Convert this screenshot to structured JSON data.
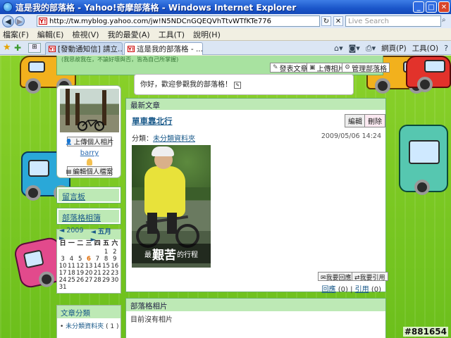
{
  "window": {
    "title": "這是我的部落格 - Yahoo!奇摩部落格 - Windows Internet Explorer",
    "url": "http://tw.myblog.yahoo.com/jw!N5NDCnGQEQVhTtvWTfKTe776",
    "search_placeholder": "Live Search",
    "url_fav": "Y!",
    "min": "_",
    "max": "□",
    "close": "✕"
  },
  "menu": [
    "檔案(F)",
    "編輯(E)",
    "檢視(V)",
    "我的最愛(A)",
    "工具(T)",
    "說明(H)"
  ],
  "tabs": [
    {
      "label": "[發動通知信] 請立...",
      "active": false
    },
    {
      "label": "這是我的部落格 - ...",
      "active": true
    }
  ],
  "commands": {
    "page": "網頁(P)",
    "tools": "工具(O)"
  },
  "topbar": {
    "blurb": "(我思故我在，不論好壞與否，皆為自己所掌握)",
    "post_btn": "發表文章",
    "upload_btn": "上傳相片",
    "manage_btn": "管理部落格"
  },
  "welcome": "你好，歡迎參觀我的部落格！",
  "profile": {
    "upload_photo": "上傳個人相片",
    "username": "barry",
    "edit_profile": "編輯個人檔案"
  },
  "sidebar": {
    "guestbook": "留言板",
    "blog_album": "部落格相簿"
  },
  "calendar": {
    "prev": "◄",
    "next": "►",
    "year": "2009",
    "month": "五月",
    "weekdays": [
      "日",
      "一",
      "二",
      "三",
      "四",
      "五",
      "六"
    ],
    "days": [
      "",
      "",
      "",
      "",
      "",
      "1",
      "2",
      "3",
      "4",
      "5",
      "6",
      "7",
      "8",
      "9",
      "10",
      "11",
      "12",
      "13",
      "14",
      "15",
      "16",
      "17",
      "18",
      "19",
      "20",
      "21",
      "22",
      "23",
      "24",
      "25",
      "26",
      "27",
      "28",
      "29",
      "30",
      "31"
    ],
    "today": "6"
  },
  "categories": {
    "title": "文章分類",
    "items": [
      {
        "name": "未分類資料夾",
        "count": "( 1 )"
      }
    ]
  },
  "latest": {
    "title": "最新文章",
    "post_title": "單車靠北行",
    "edit": "編輯",
    "delete": "刪除",
    "category_label": "分類：",
    "category": "未分類資料夾",
    "date": "2009/05/06 14:24",
    "caption_pre": "最",
    "caption_big": "艱苦",
    "caption_post": "的行程",
    "reply_btn": "我要回應",
    "cite_btn": "我要引用",
    "reply_link": "回應",
    "reply_count": "(0)",
    "cite_link": "引用",
    "cite_count": "(0)",
    "separator": "|"
  },
  "album": {
    "title": "部落格相片",
    "empty": "目前沒有相片"
  },
  "watermark": "#881654"
}
